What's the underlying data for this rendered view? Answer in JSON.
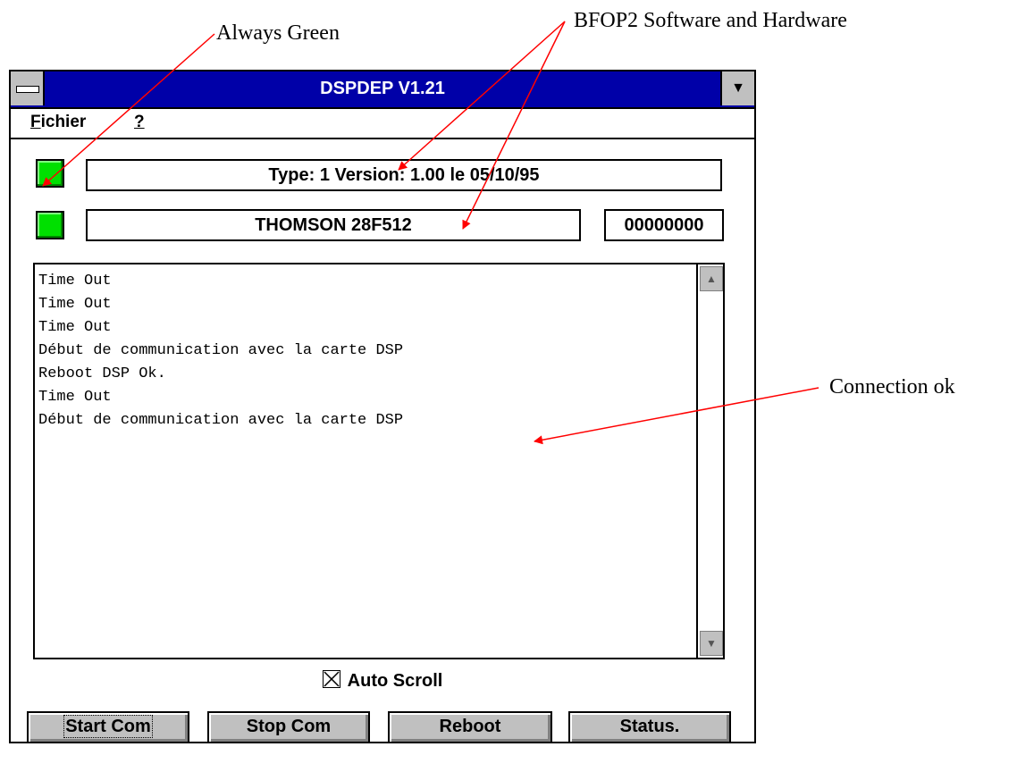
{
  "annotations": {
    "always_green": "Always Green",
    "bfop2": "BFOP2 Software and Hardware",
    "connection_ok": "Connection ok",
    "arrow_color": "#ff0000"
  },
  "window": {
    "title": "DSPDEP V1.21",
    "dropdown_glyph": "▼"
  },
  "menu": {
    "fichier": "ichier",
    "fichier_mnemonic": "F",
    "help": "?"
  },
  "status": {
    "type_version": "Type: 1 Version:  1.00 le 05/10/95",
    "flash_chip": "THOMSON 28F512",
    "counter": "00000000",
    "led_color": "#00e000"
  },
  "log": {
    "lines": [
      "Time Out",
      "Time Out",
      "Time Out",
      "Début de communication avec la carte DSP",
      "Reboot DSP Ok.",
      "Time Out",
      "Début de communication avec la carte DSP"
    ]
  },
  "auto_scroll": {
    "label": "Auto Scroll",
    "checked": true
  },
  "buttons": {
    "start": "Start Com",
    "stop": "Stop Com",
    "reboot": "Reboot",
    "status": "Status."
  }
}
